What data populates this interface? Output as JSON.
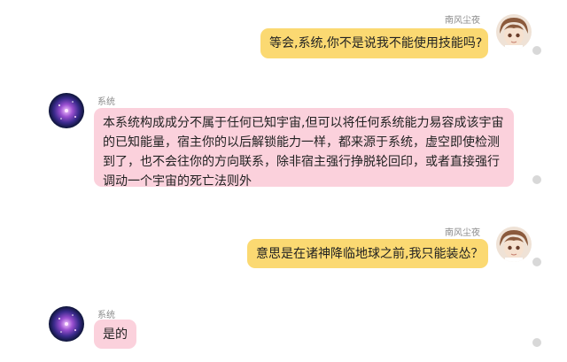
{
  "conversation": {
    "messages": [
      {
        "sender": "南风尘夜",
        "role": "user",
        "text": "等会,系统,你不是说我不能使用技能吗?",
        "avatar_icon": "anime-boy-avatar-icon"
      },
      {
        "sender": "系统",
        "role": "system",
        "text": "本系统构成成分不属于任何已知宇宙,但可以将任何系统能力易容成该宇宙的已知能量，宿主你的以后解锁能力一样，都来源于系统，虚空即使检测到了，也不会往你的方向联系，除非宿主强行挣脱轮回印，或者直接强行调动一个宇宙的死亡法则外",
        "avatar_icon": "galaxy-avatar-icon"
      },
      {
        "sender": "南风尘夜",
        "role": "user",
        "text": "意思是在诸神降临地球之前,我只能装怂？",
        "avatar_icon": "anime-boy-avatar-icon"
      },
      {
        "sender": "系统",
        "role": "system",
        "text": "是的",
        "avatar_icon": "galaxy-avatar-icon"
      }
    ]
  },
  "colors": {
    "user_bubble": "#fbd972",
    "system_bubble": "#fbd1dc",
    "status_dot": "#d8d8d8"
  }
}
